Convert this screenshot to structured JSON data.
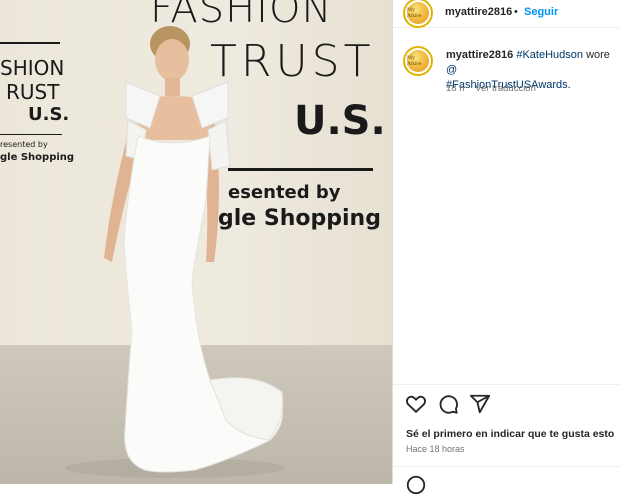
{
  "post": {
    "username": "myattire2816",
    "follow_label": "Seguir",
    "separator": "•",
    "caption_user": "myattire2816",
    "caption_mention": "#KateHudson",
    "caption_mid": " wore ",
    "caption_cut": "@",
    "caption_hashtag": "#FashionTrustUSAwards",
    "caption_end": ".",
    "age": "18 h",
    "translate_label": "Ver traducción",
    "likes_text": "Sé el primero en indicar que te gusta esto",
    "timestamp": "Hace 18 horas",
    "avatar_text": "My Attire"
  },
  "photo": {
    "wall_lines": [
      "FASHION",
      "TRUST",
      "U.S.",
      "esented by",
      "gle Shopping"
    ],
    "side_lines": [
      "SHION",
      "RUST",
      "U.S.",
      "resented by",
      "gle Shopping"
    ]
  },
  "colors": {
    "link": "#0095f6",
    "text": "#262626",
    "muted": "#737373",
    "avatar_ring": "#e0b400"
  },
  "icons": [
    "heart-icon",
    "comment-icon",
    "share-icon"
  ]
}
